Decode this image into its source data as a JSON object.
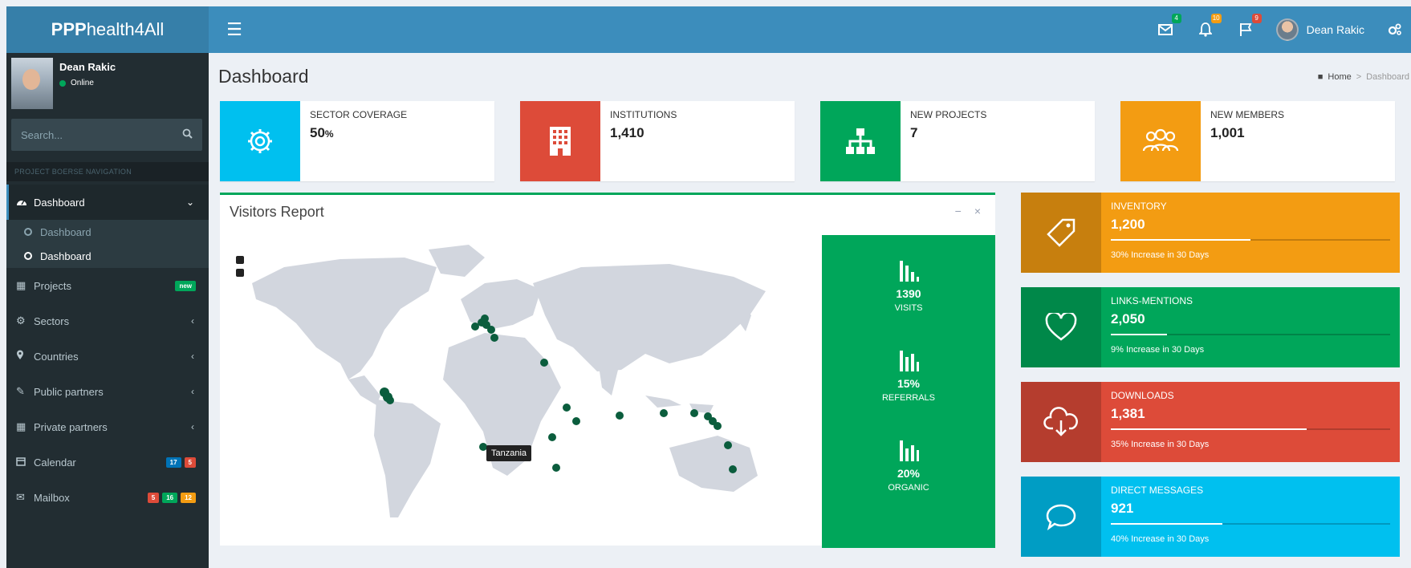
{
  "header": {
    "logo_bold": "PPP",
    "logo_rest": "health4All",
    "menu_icon": "hamburger-icon",
    "mail_count": "4",
    "notif_count": "10",
    "flag_count": "9",
    "user_name": "Dean Rakic",
    "colors": {
      "logo_bg": "#367fa9",
      "navbar_bg": "#3c8dbc"
    }
  },
  "sidebar": {
    "user_name": "Dean Rakic",
    "status": "Online",
    "search_placeholder": "Search...",
    "nav_header": "PROJECT BOERSE NAVIGATION",
    "items": [
      {
        "label": "Dashboard",
        "icon": "dashboard-icon"
      },
      {
        "label": "Dashboard",
        "icon": "circle-icon"
      },
      {
        "label": "Dashboard",
        "icon": "circle-icon"
      },
      {
        "label": "Projects",
        "icon": "grid-icon",
        "badge": "new"
      },
      {
        "label": "Sectors",
        "icon": "gears-icon"
      },
      {
        "label": "Countries",
        "icon": "map-marker-icon"
      },
      {
        "label": "Public partners",
        "icon": "edit-icon"
      },
      {
        "label": "Private partners",
        "icon": "table-icon"
      },
      {
        "label": "Calendar",
        "icon": "calendar-icon",
        "badges": [
          "17",
          "5"
        ]
      },
      {
        "label": "Mailbox",
        "icon": "envelope-icon",
        "badges": [
          "5",
          "16",
          "12"
        ]
      }
    ]
  },
  "content": {
    "title": "Dashboard",
    "breadcrumb": {
      "home": "Home",
      "current": "Dashboard"
    }
  },
  "info_boxes": [
    {
      "label": "SECTOR COVERAGE",
      "value": "50",
      "unit": "%",
      "icon": "gear-icon",
      "color": "#00c0ef"
    },
    {
      "label": "INSTITUTIONS",
      "value": "1,410",
      "icon": "building-icon",
      "color": "#dd4b39"
    },
    {
      "label": "NEW PROJECTS",
      "value": "7",
      "icon": "sitemap-icon",
      "color": "#00a65a"
    },
    {
      "label": "NEW MEMBERS",
      "value": "1,001",
      "icon": "users-icon",
      "color": "#f39c12"
    }
  ],
  "visitors": {
    "title": "Visitors Report",
    "tooltip": "Tanzania",
    "stats": [
      {
        "value": "1390",
        "label": "VISITS"
      },
      {
        "value": "15%",
        "label": "REFERRALS"
      },
      {
        "value": "20%",
        "label": "ORGANIC"
      }
    ]
  },
  "small_boxes": [
    {
      "label": "INVENTORY",
      "value": "1,200",
      "progress": 0.5,
      "desc": "30% Increase in 30 Days",
      "icon": "tag-icon",
      "color": "#f39c12"
    },
    {
      "label": "LINKS-MENTIONS",
      "value": "2,050",
      "progress": 0.2,
      "desc": "9% Increase in 30 Days",
      "icon": "heart-icon",
      "color": "#00a65a"
    },
    {
      "label": "DOWNLOADS",
      "value": "1,381",
      "progress": 0.7,
      "desc": "35% Increase in 30 Days",
      "icon": "cloud-download-icon",
      "color": "#dd4b39"
    },
    {
      "label": "DIRECT MESSAGES",
      "value": "921",
      "progress": 0.4,
      "desc": "40% Increase in 30 Days",
      "icon": "comment-icon",
      "color": "#00c0ef"
    }
  ]
}
